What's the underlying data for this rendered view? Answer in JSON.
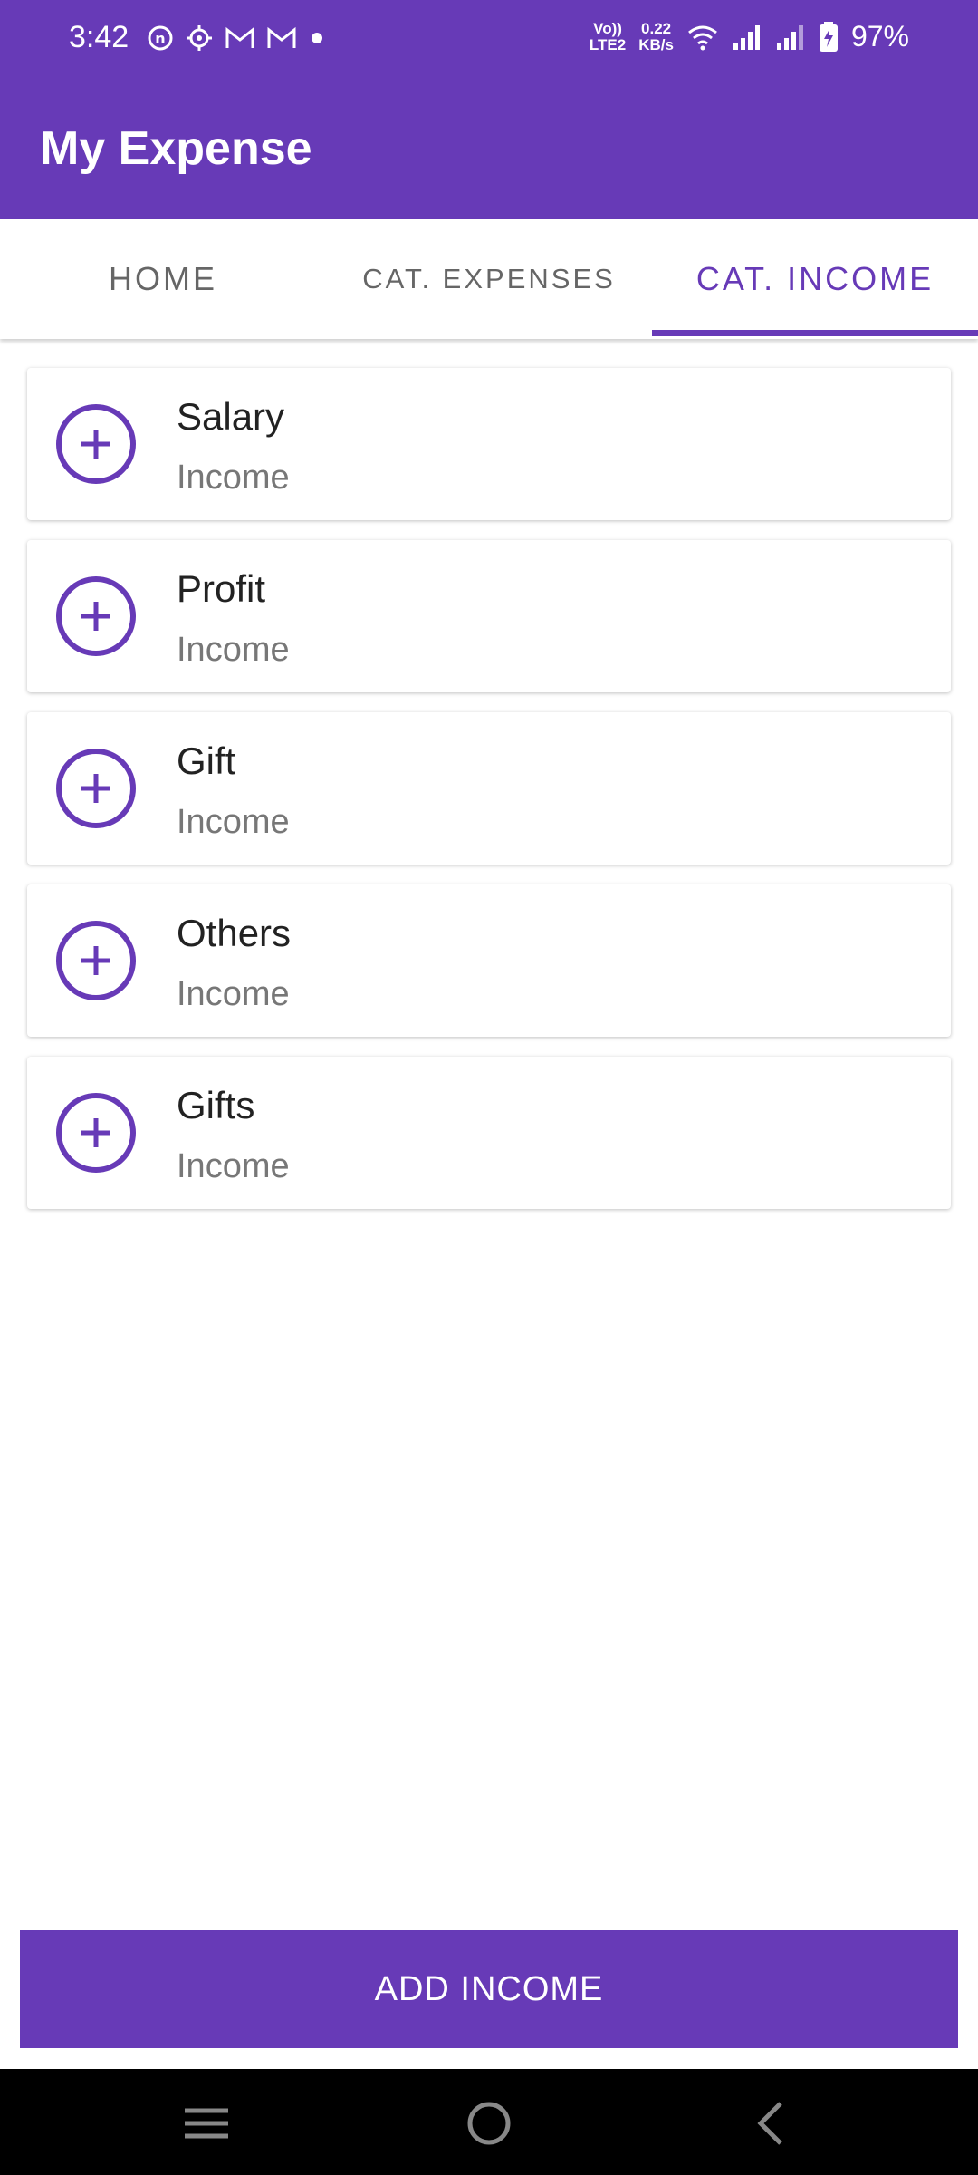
{
  "status_bar": {
    "time": "3:42",
    "left_icons": [
      "notification-icon",
      "settings-icon",
      "gmail-icon",
      "gmail-icon",
      "dot-icon"
    ],
    "volte": "Vo))\nLTE2",
    "speed": "0.22\nKB/s",
    "battery": "97%"
  },
  "app_bar": {
    "title": "My Expense"
  },
  "tabs": [
    {
      "label": "HOME"
    },
    {
      "label": "CAT. EXPENSES"
    },
    {
      "label": "CAT. INCOME",
      "selected": true
    }
  ],
  "categories": [
    {
      "title": "Salary",
      "type": "Income"
    },
    {
      "title": "Profit",
      "type": "Income"
    },
    {
      "title": "Gift",
      "type": "Income"
    },
    {
      "title": "Others",
      "type": "Income"
    },
    {
      "title": "Gifts",
      "type": "Income"
    }
  ],
  "add_button": {
    "label": "ADD INCOME"
  },
  "colors": {
    "primary": "#673ab7",
    "subtitle": "#777777"
  }
}
